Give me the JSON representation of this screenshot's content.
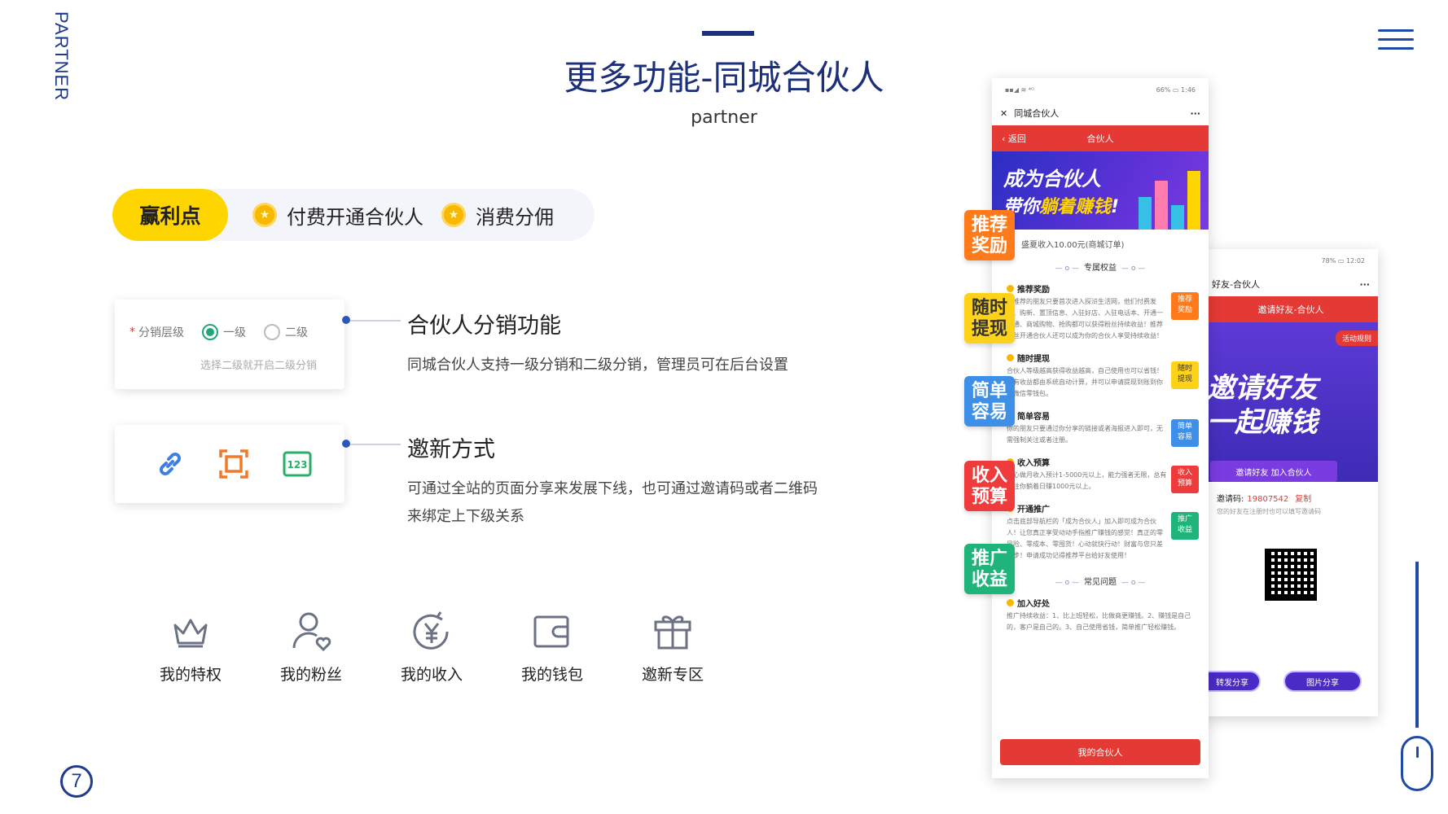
{
  "side_label": "PARTNER",
  "title": "更多功能-同城合伙人",
  "subtitle": "partner",
  "page_number": "7",
  "tabs": {
    "active": "赢利点",
    "items": [
      "付费开通合伙人",
      "消费分佣"
    ]
  },
  "card1": {
    "field_label": "分销层级",
    "option1": "一级",
    "option2": "二级",
    "hint": "选择二级就开启二级分销"
  },
  "feature1": {
    "title": "合伙人分销功能",
    "desc": "同城合伙人支持一级分销和二级分销，管理员可在后台设置"
  },
  "feature2": {
    "title": "邀新方式",
    "desc": "可通过全站的页面分享来发展下线，也可通过邀请码或者二维码来绑定上下级关系"
  },
  "bottom_icons": [
    {
      "label": "我的特权",
      "icon": "crown-icon"
    },
    {
      "label": "我的粉丝",
      "icon": "user-heart-icon"
    },
    {
      "label": "我的收入",
      "icon": "yen-coin-icon"
    },
    {
      "label": "我的钱包",
      "icon": "wallet-icon"
    },
    {
      "label": "邀新专区",
      "icon": "gift-icon"
    }
  ],
  "float_tags": [
    {
      "line1": "推荐",
      "line2": "奖励",
      "color": "#ff7a1a"
    },
    {
      "line1": "随时",
      "line2": "提现",
      "color": "#ffd21a"
    },
    {
      "line1": "简单",
      "line2": "容易",
      "color": "#3d8fe8"
    },
    {
      "line1": "收入",
      "line2": "预算",
      "color": "#ef3b3b"
    },
    {
      "line1": "推广",
      "line2": "收益",
      "color": "#1fb57a"
    }
  ],
  "phone1": {
    "status_left": "▪▪◢ ≋ ⁴ᴳ",
    "status_right": "66% ▭ 1:46",
    "wx_title": "同城合伙人",
    "back": "返回",
    "red_title": "合伙人",
    "banner_line1": "成为合伙人",
    "banner_line2a": "带你",
    "banner_line2b": "躺着赚钱",
    "banner_line2c": "!",
    "income": "盛夏收入10.00元(商城订单)",
    "section1": "专属权益",
    "benefits": [
      {
        "h": "推荐奖励",
        "p": "你推荐的朋友只要首次进入探浒生活网，他们付费发布、购新、置顶信息、入驻好店、入驻电话本、开通一卡通、商城购物、抢购都可以获得粉丝持续收益！推荐粉丝开通合伙人还可以成为你的合伙人享受持续收益！",
        "tag1": "推荐",
        "tag2": "奖励",
        "color": "#ff7a1a"
      },
      {
        "h": "随时提现",
        "p": "合伙人等级越高获得收益越高，自己使用也可以省钱！所有收益都由系统自动计算，并可以申请提现到账到你的微信零钱包。",
        "tag1": "随时",
        "tag2": "提现",
        "color": "#ffd21a"
      },
      {
        "h": "简单容易",
        "p": "你的朋友只要通过你分享的链接或者海报进入即可，无需强制关注或者注册。",
        "tag1": "简单",
        "tag2": "容易",
        "color": "#3d8fe8"
      },
      {
        "h": "收入预算",
        "p": "用心做月收入预计1-5000元以上，能力强者无限，总有关注你躺着日赚1000元以上。",
        "tag1": "收入",
        "tag2": "预算",
        "color": "#ef3b3b"
      },
      {
        "h": "开通推广",
        "p": "点击底部导航栏的「成为合伙人」加入即可成为合伙人！让您真正享受动动手指推广赚钱的感觉！真正的零风险、零成本、零囤货！心动就快行动！财富与您只差一步！申请成功记得推荐平台给好友使用！",
        "tag1": "推广",
        "tag2": "收益",
        "color": "#1fb57a"
      }
    ],
    "section2": "常见问题",
    "faq_h": "加入好处",
    "faq_p": "推广持续收益：1、比上班轻松，比做商更赚钱。2、赚钱是自己的，客户是自己的。3、自己使用省钱，简单推广轻松赚钱。",
    "button": "我的合伙人"
  },
  "phone2": {
    "status_right": "78% ▭ 12:02",
    "wx_title": "好友-合伙人",
    "red_title": "邀请好友-合伙人",
    "rule": "活动规则",
    "big_line1": "邀请好友",
    "big_line2": "一起赚钱",
    "cta": "邀请好友 加入合伙人",
    "invite_label": "邀请码:",
    "invite_code": "19807542",
    "copy": "复制",
    "invite_hint": "您的好友在注册时也可以填写邀请码",
    "share1": "转发分享",
    "share2": "图片分享"
  }
}
